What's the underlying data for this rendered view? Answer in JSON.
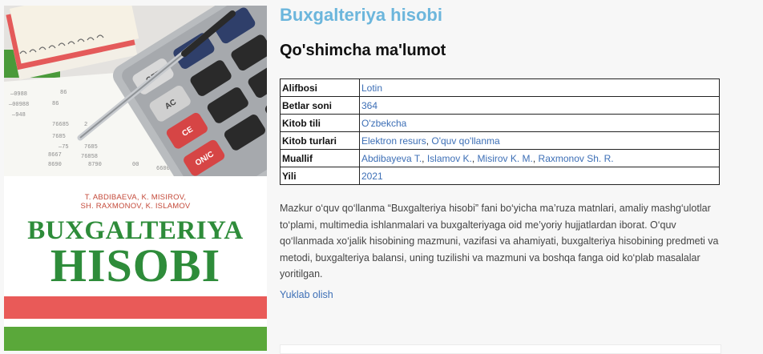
{
  "cover": {
    "authors_line1": "T. ABDIBAEVA, K. MISIROV,",
    "authors_line2": "SH. RAXMONOV, K. ISLAMOV",
    "title_line1": "BUXGALTERIYA",
    "title_line2": "HISOBI",
    "calculator_keys": [
      "OFF",
      "AC",
      "CE",
      "ON/C"
    ]
  },
  "book": {
    "title": "Buxgalteriya hisobi",
    "section_title": "Qo'shimcha ma'lumot",
    "rows": [
      {
        "label": "Alifbosi",
        "values": [
          "Lotin"
        ]
      },
      {
        "label": "Betlar soni",
        "values": [
          "364"
        ]
      },
      {
        "label": "Kitob tili",
        "values": [
          "O'zbekcha"
        ]
      },
      {
        "label": "Kitob turlari",
        "values": [
          "Elektron resurs",
          "O'quv qo'llanma"
        ]
      },
      {
        "label": "Muallif",
        "values": [
          "Abdibayeva T.",
          "Islamov K.",
          "Misirov K. M.",
          "Raxmonov Sh. R."
        ]
      },
      {
        "label": "Yili",
        "values": [
          "2021"
        ]
      }
    ],
    "description": "Mazkur o‘quv qo‘llanma “Buxgalteriya hisobi” fani bo‘yicha ma’ruza matnlari, amaliy mashg‘ulotlar to‘plami, multimedia ishlanmalari va buxgalteriyaga oid me’yoriy hujjatlardan iborat. O‘quv qo‘llanmada xo‘jalik hisobining mazmuni, vazifasi va ahamiyati, buxgalteriya hisobining predmeti va metodi, buxgalteriya balansi, uning tuzilishi va mazmuni va boshqa fanga oid ko‘plab masalalar yoritilgan.",
    "download_label": "Yuklab olish"
  },
  "colors": {
    "title_blue": "#6cb6dc",
    "link_blue": "#3d6fb6",
    "cover_green": "#2e8c3a",
    "cover_red": "#e95a58"
  }
}
